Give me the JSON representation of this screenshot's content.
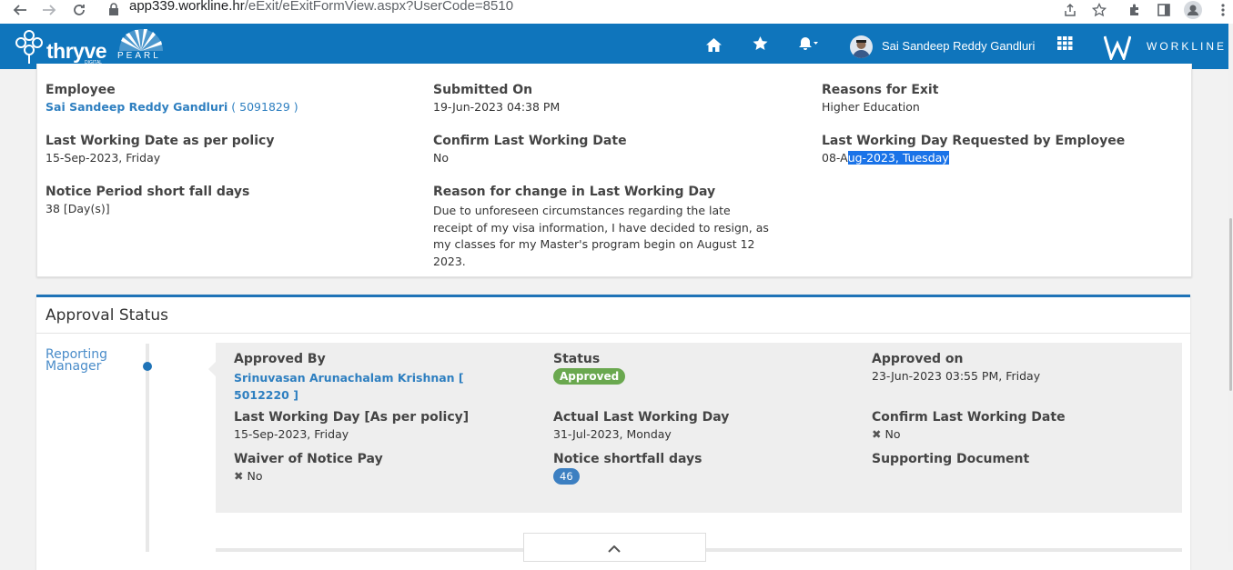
{
  "browser": {
    "url_host": "app339.workline.hr",
    "url_path": "/eExit/eExitFormView.aspx?UserCode=8510"
  },
  "header": {
    "brand_logo": "thryve",
    "brand_logo_sub": "DIGITAL",
    "pearl_logo": "PEARL",
    "user_name": "Sai Sandeep Reddy Gandluri",
    "workline_logo": "WORKLINE",
    "accent_color": "#0f75bc"
  },
  "details": {
    "employee_label": "Employee",
    "employee_name": "Sai Sandeep Reddy Gandluri",
    "employee_code": "( 5091829 )",
    "submitted_on_label": "Submitted On",
    "submitted_on_value": "19-Jun-2023 04:38 PM",
    "reasons_label": "Reasons for Exit",
    "reasons_value": "Higher Education",
    "lwd_policy_label": "Last Working Date as per policy",
    "lwd_policy_value": "15-Sep-2023, Friday",
    "confirm_lwd_label": "Confirm Last Working Date",
    "confirm_lwd_value": "No",
    "lwd_requested_label": "Last Working Day Requested by Employee",
    "lwd_requested_value_prefix": "08-A",
    "lwd_requested_value_selected": "ug-2023, Tuesday",
    "notice_shortfall_label": "Notice Period short fall days",
    "notice_shortfall_value": "38 [Day(s)]",
    "reason_change_label": "Reason for change in Last Working Day",
    "reason_change_value": "Due to unforeseen circumstances regarding the late receipt of my visa information, I have decided to resign, as my classes for my Master's program begin on August 12 2023."
  },
  "approval": {
    "title": "Approval Status",
    "stage_label": "Reporting Manager",
    "approved_by_label": "Approved By",
    "approved_by_value": "Srinuvasan Arunachalam Krishnan [ 5012220 ]",
    "status_label": "Status",
    "status_value": "Approved",
    "approved_on_label": "Approved on",
    "approved_on_value": "23-Jun-2023 03:55 PM, Friday",
    "lwd_policy_label": "Last Working Day [As per policy]",
    "lwd_policy_value": "15-Sep-2023, Friday",
    "actual_lwd_label": "Actual Last Working Day",
    "actual_lwd_value": "31-Jul-2023, Monday",
    "confirm_lwd_label": "Confirm Last Working Date",
    "confirm_lwd_value": "No",
    "waiver_label": "Waiver of Notice Pay",
    "waiver_value": "No",
    "notice_shortfall_label": "Notice shortfall days",
    "notice_shortfall_value": "46",
    "supporting_doc_label": "Supporting Document",
    "status_color": "#6aa84f"
  }
}
